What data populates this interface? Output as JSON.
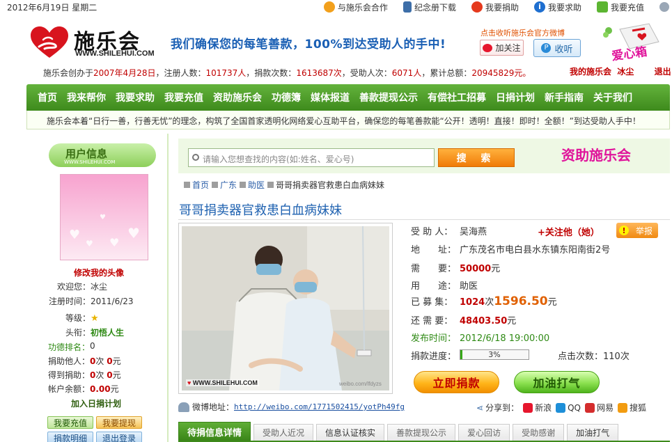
{
  "topbar": {
    "date": "2012年6月19日 星期二",
    "links": [
      {
        "label": "与施乐会合作",
        "icon": "flower-icon",
        "color": "#f2a01c"
      },
      {
        "label": "纪念册下载",
        "icon": "book-icon",
        "color": "#3d6ea8"
      },
      {
        "label": "我要捐助",
        "icon": "heart-icon",
        "color": "#e53a1e"
      },
      {
        "label": "我要求助",
        "icon": "info-icon",
        "color": "#1f6fd0"
      },
      {
        "label": "我要充值",
        "icon": "card-icon",
        "color": "#5cb532"
      }
    ]
  },
  "header": {
    "logo_name": "施乐会",
    "logo_url": "WWW.SHILEHUI.COM",
    "slogan": "我们确保您的每笔善款，100%到达受助人的手中!",
    "weibo_tip": "点击收听施乐会官方微博",
    "follow_label": "加关注",
    "listen_label": "收听",
    "donation_box_text": "爱心箱"
  },
  "stats": {
    "founded_prefix": "施乐会创办于",
    "founded": "2007年4月28日",
    "registered_label": "，注册人数：",
    "registered": "101737人",
    "donations_label": "，捐款次数：",
    "donations": "1613687次",
    "recipients_label": "，受助人次：",
    "recipients": "6071人",
    "total_label": "，累计总额：",
    "total": "20945829元。"
  },
  "user_links": {
    "my_site": "我的施乐会",
    "username": "冰尘",
    "logout": "退出"
  },
  "nav": [
    "首页",
    "我来帮你",
    "我要求助",
    "我要充值",
    "资助施乐会",
    "功德簿",
    "媒体报道",
    "善款提现公示",
    "有偿社工招募",
    "日捐计划",
    "新手指南",
    "关于我们"
  ],
  "notice": "施乐会本着“日行一善，行善无忧”的理念，构筑了全国首家透明化网络爱心互助平台，确保您的每笔善款能“公开！透明！直接！即时！全额！”到达受助人手中！",
  "sidebar": {
    "title": "用户信息",
    "title_url": "WWW.SHILEHUI.COM",
    "change_avatar": "修改我的头像",
    "welcome_label": "欢迎您：",
    "welcome_value": "冰尘",
    "reg_time_label": "注册时间：",
    "reg_time_value": "2011/6/23",
    "level_label": "等级：",
    "rank_title_label": "头衔：",
    "rank_title_value": "初悟人生",
    "merit_rank_label": "功德排名：",
    "merit_rank_value": "0",
    "donated_label": "捐助他人：",
    "donated_count": "0",
    "donated_unit": "次",
    "donated_amount": "0",
    "donated_amount_unit": "元",
    "received_label": "得到捐助：",
    "received_count": "0",
    "received_unit": "次",
    "received_amount": "0",
    "received_amount_unit": "元",
    "balance_label": "帐户余额：",
    "balance_value": "0.00",
    "balance_unit": "元",
    "plan_label": "加入日捐计划",
    "buttons": [
      "我要充值",
      "我要提现",
      "捐款明细",
      "退出登录"
    ]
  },
  "search": {
    "placeholder": "请输入您想查找的内容(如:姓名、爱心号)",
    "button": "搜 索",
    "sponsor_label": "资助施乐会"
  },
  "breadcrumb": [
    "首页",
    "广东",
    "助医"
  ],
  "breadcrumb_current": "哥哥捐卖器官救患白血病妹妹",
  "case": {
    "title": "哥哥捐卖器官救患白血病妹妹",
    "photo_watermark": "WWW.SHILEHUI.COM",
    "photo_weibo_mark": "weibo.com/lfdyzs",
    "recipient_label": "受 助 人：",
    "recipient": "吴海燕",
    "follow": "关注他（她）",
    "report": "举报",
    "address_label": "地　　址：",
    "address": "广东茂名市电白县水东镇东阳南街2号",
    "need_label": "需　　要：",
    "need": "50000",
    "need_unit": "元",
    "usage_label": "用　　途：",
    "usage": "助医",
    "raised_label": "已 募 集：",
    "raised_times": "1024",
    "raised_times_unit": "次",
    "raised_amount": "1596.50",
    "raised_unit": "元",
    "remaining_label": "还 需 要：",
    "remaining": "48403.50",
    "remaining_unit": "元",
    "publish_label": "发布时间：",
    "publish_time": "2012/6/18 19:00:00",
    "progress_label": "捐款进度：",
    "progress_pct": 3,
    "progress_text": "3%",
    "clicks_label": "点击次数：",
    "clicks": "110次",
    "donate_btn": "立即捐款",
    "cheer_btn": "加油打气"
  },
  "weibo": {
    "label": "微博地址：",
    "url": "http://weibo.com/1771502415/yotPh49fg"
  },
  "share": {
    "label": "分享到：",
    "items": [
      {
        "label": "新浪",
        "color": "#e6162d"
      },
      {
        "label": "QQ",
        "color": "#1e8fd8"
      },
      {
        "label": "网易",
        "color": "#d42d2d"
      },
      {
        "label": "搜狐",
        "color": "#f29c11"
      }
    ]
  },
  "tabs": [
    "待捐信息详情",
    "受助人近况",
    "信息认证核实",
    "善款提现公示",
    "爱心回访",
    "受助感谢",
    "加油打气"
  ]
}
